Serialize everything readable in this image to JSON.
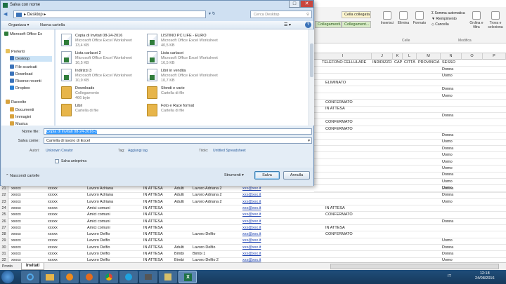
{
  "excel": {
    "ribbon": {
      "styles": [
        "Cella collegata",
        "Collegamenti...",
        "Collegament..."
      ],
      "buttons": [
        "Inserisci",
        "Elimina",
        "Formato"
      ],
      "right_items": [
        "Somma automatica",
        "Riempimento",
        "Cancella",
        "Ordina e filtra",
        "Trova e seleziona"
      ],
      "group_labels": [
        "Celle",
        "Modifica"
      ]
    },
    "columns": [
      "I",
      "J",
      "K",
      "L",
      "M",
      "N",
      "O",
      "P"
    ],
    "header_row": {
      "telefono": "TELEFONO CELLULARE",
      "indirizzo": "INDIRIZZO",
      "cap": "CAP",
      "citta": "CITTÀ",
      "provincia": "PROVINCIA",
      "sesso": "SESSO"
    },
    "upper_rows": [
      {
        "stato": "",
        "sesso": "Donna"
      },
      {
        "stato": "",
        "sesso": "Uomo"
      },
      {
        "stato": "ELIMINATO",
        "sesso": ""
      },
      {
        "stato": "",
        "sesso": "Donna"
      },
      {
        "stato": "",
        "sesso": "Uomo"
      },
      {
        "stato": "CONFERMATO",
        "sesso": ""
      },
      {
        "stato": "IN ATTESA",
        "sesso": ""
      },
      {
        "stato": "",
        "sesso": "Donna"
      },
      {
        "stato": "CONFERMATO",
        "sesso": ""
      },
      {
        "stato": "CONFERMATO",
        "sesso": ""
      },
      {
        "stato": "",
        "sesso": "Donna"
      },
      {
        "stato": "",
        "sesso": "Uomo"
      },
      {
        "stato": "",
        "sesso": "Donna"
      },
      {
        "stato": "",
        "sesso": "Uomo"
      },
      {
        "stato": "",
        "sesso": "Uomo"
      },
      {
        "stato": "",
        "sesso": "Uomo"
      },
      {
        "stato": "",
        "sesso": "Donna"
      },
      {
        "stato": "",
        "sesso": "Uomo"
      },
      {
        "stato": "",
        "sesso": "Uomo"
      }
    ],
    "rows": [
      {
        "num": "21",
        "a": "xxxxx",
        "b": "xxxxx",
        "c": "Lavoro Adriana",
        "d": "IN ATTESA",
        "e": "Adulti",
        "f": "Lavoro Adriana 2",
        "g": "xxx@xxx.it",
        "h": "",
        "i": "",
        "j": "Donna"
      },
      {
        "num": "22",
        "a": "xxxxx",
        "b": "xxxxx",
        "c": "Lavoro Adriana",
        "d": "IN ATTESA",
        "e": "Adulti",
        "f": "Lavoro Adriana 2",
        "g": "xxx@xxx.it",
        "h": "",
        "i": "",
        "j": "Donna"
      },
      {
        "num": "23",
        "a": "xxxxx",
        "b": "xxxxx",
        "c": "Lavoro Adriana",
        "d": "IN ATTESA",
        "e": "Adulti",
        "f": "Lavoro Adriana 2",
        "g": "xxx@xxx.it",
        "h": "",
        "i": "",
        "j": "Uomo"
      },
      {
        "num": "24",
        "a": "xxxxx",
        "b": "xxxxx",
        "c": "Amici comuni",
        "d": "IN ATTESA",
        "e": "",
        "f": "",
        "g": "xxx@xxx.it",
        "h": "",
        "i": "IN ATTESA",
        "j": ""
      },
      {
        "num": "25",
        "a": "xxxxx",
        "b": "xxxxx",
        "c": "Amici comuni",
        "d": "IN ATTESA",
        "e": "",
        "f": "",
        "g": "xxx@xxx.it",
        "h": "",
        "i": "CONFERMATO",
        "j": ""
      },
      {
        "num": "26",
        "a": "xxxxx",
        "b": "xxxxx",
        "c": "Amici comuni",
        "d": "IN ATTESA",
        "e": "",
        "f": "",
        "g": "xxx@xxx.it",
        "h": "",
        "i": "",
        "j": "Donna"
      },
      {
        "num": "27",
        "a": "xxxxx",
        "b": "xxxxx",
        "c": "Amici comuni",
        "d": "IN ATTESA",
        "e": "",
        "f": "",
        "g": "xxx@xxx.it",
        "h": "",
        "i": "IN ATTESA",
        "j": ""
      },
      {
        "num": "28",
        "a": "xxxxx",
        "b": "xxxxx",
        "c": "Lavoro Delfio",
        "d": "IN ATTESA",
        "e": "",
        "f": "Lavoro Delfio",
        "g": "xxx@xxx.it",
        "h": "",
        "i": "CONFERMATO",
        "j": ""
      },
      {
        "num": "29",
        "a": "xxxxx",
        "b": "xxxxx",
        "c": "Lavoro Delfio",
        "d": "IN ATTESA",
        "e": "",
        "f": "",
        "g": "xxx@xxx.it",
        "h": "",
        "i": "",
        "j": "Uomo"
      },
      {
        "num": "30",
        "a": "xxxxx",
        "b": "xxxxx",
        "c": "Lavoro Delfio",
        "d": "IN ATTESA",
        "e": "Adulti",
        "f": "Lavoro Delfio",
        "g": "xxx@xxx.it",
        "h": "",
        "i": "",
        "j": "Donna"
      },
      {
        "num": "31",
        "a": "xxxxx",
        "b": "xxxxx",
        "c": "Lavoro Delfio",
        "d": "IN ATTESA",
        "e": "Bimbi",
        "f": "Bimbi 1",
        "g": "xxx@xxx.it",
        "h": "",
        "i": "",
        "j": "Donna"
      },
      {
        "num": "32",
        "a": "xxxxx",
        "b": "xxxxx",
        "c": "Lavoro Delfio",
        "d": "IN ATTESA",
        "e": "Bimbi",
        "f": "Lavoro Delfio 2",
        "g": "xxx@xxx.it",
        "h": "",
        "i": "",
        "j": "Uomo"
      }
    ],
    "sheet_tab": "Invitati",
    "status": "Pronto"
  },
  "dialog": {
    "title": "Salva con nome",
    "address": "Desktop",
    "search_placeholder": "Cerca Desktop",
    "cmd": {
      "organize": "Organizza ▾",
      "new_folder": "Nuova cartella"
    },
    "nav": [
      {
        "label": "Microsoft Office Ex",
        "color": "#2f7d3a"
      },
      {
        "label": "Preferiti",
        "color": "#e8c15a"
      },
      {
        "label": "Desktop",
        "color": "#3b73b9"
      },
      {
        "label": "File scaricati",
        "color": "#3b73b9"
      },
      {
        "label": "Download",
        "color": "#3b73b9"
      },
      {
        "label": "Risorse recenti",
        "color": "#3b73b9"
      },
      {
        "label": "Dropbox",
        "color": "#2a7fd4"
      },
      {
        "label": "Raccolte",
        "color": "#d8a23d"
      },
      {
        "label": "Documenti",
        "color": "#d8a23d"
      },
      {
        "label": "Immagini",
        "color": "#d8a23d"
      },
      {
        "label": "Musica",
        "color": "#d8a23d"
      }
    ],
    "files": [
      {
        "name": "Copia di Invitati 08-24-2016",
        "type": "Microsoft Office Excel Worksheet",
        "size": "13,4 KB",
        "icon": "excel-file-icon"
      },
      {
        "name": "LISTINO PC LIFE - EURO",
        "type": "Microsoft Office Excel Worksheet",
        "size": "40,5 KB",
        "icon": "excel-file-icon"
      },
      {
        "name": "Lista carlacei 2",
        "type": "Microsoft Office Excel Worksheet",
        "size": "16,5 KB",
        "icon": "excel-file-icon"
      },
      {
        "name": "Lista carlacei",
        "type": "Microsoft Office Excel Worksheet",
        "size": "16,5 KB",
        "icon": "excel-file-icon"
      },
      {
        "name": "Indirizzi 3",
        "type": "Microsoft Office Excel Worksheet",
        "size": "10,9 KB",
        "icon": "excel-file-icon"
      },
      {
        "name": "Libri in vendita",
        "type": "Microsoft Office Excel Worksheet",
        "size": "10,7 KB",
        "icon": "excel-file-icon"
      },
      {
        "name": "Downloads",
        "type": "Collegamento",
        "size": "466 byte",
        "icon": "folder-shortcut-icon"
      },
      {
        "name": "Sfondi e varie",
        "type": "Cartella di file",
        "size": "",
        "icon": "folder-icon"
      },
      {
        "name": "Libri",
        "type": "Cartella di file",
        "size": "",
        "icon": "folder-icon"
      },
      {
        "name": "Foto e Race format",
        "type": "Cartella di file",
        "size": "",
        "icon": "folder-icon"
      }
    ],
    "filename_label": "Nome file:",
    "filename_value": "Copia di Invitati 08-24-2016-2",
    "savetype_label": "Salva come:",
    "savetype_value": "Cartella di lavoro di Excel",
    "meta": {
      "authors_label": "Autori:",
      "authors_value": "Unknown Creator",
      "tags_label": "Tag:",
      "tags_value": "Aggiungi tag",
      "title_label": "Titolo:",
      "title_value": "Untitled Spreadsheet"
    },
    "thumbnail_label": "Salva anteprima",
    "hide_folders": "Nascondi cartelle",
    "tools": "Strumenti",
    "save": "Salva",
    "cancel": "Annulla"
  },
  "taskbar": {
    "lang": "IT",
    "time": "12:18",
    "date": "24/08/2016"
  }
}
